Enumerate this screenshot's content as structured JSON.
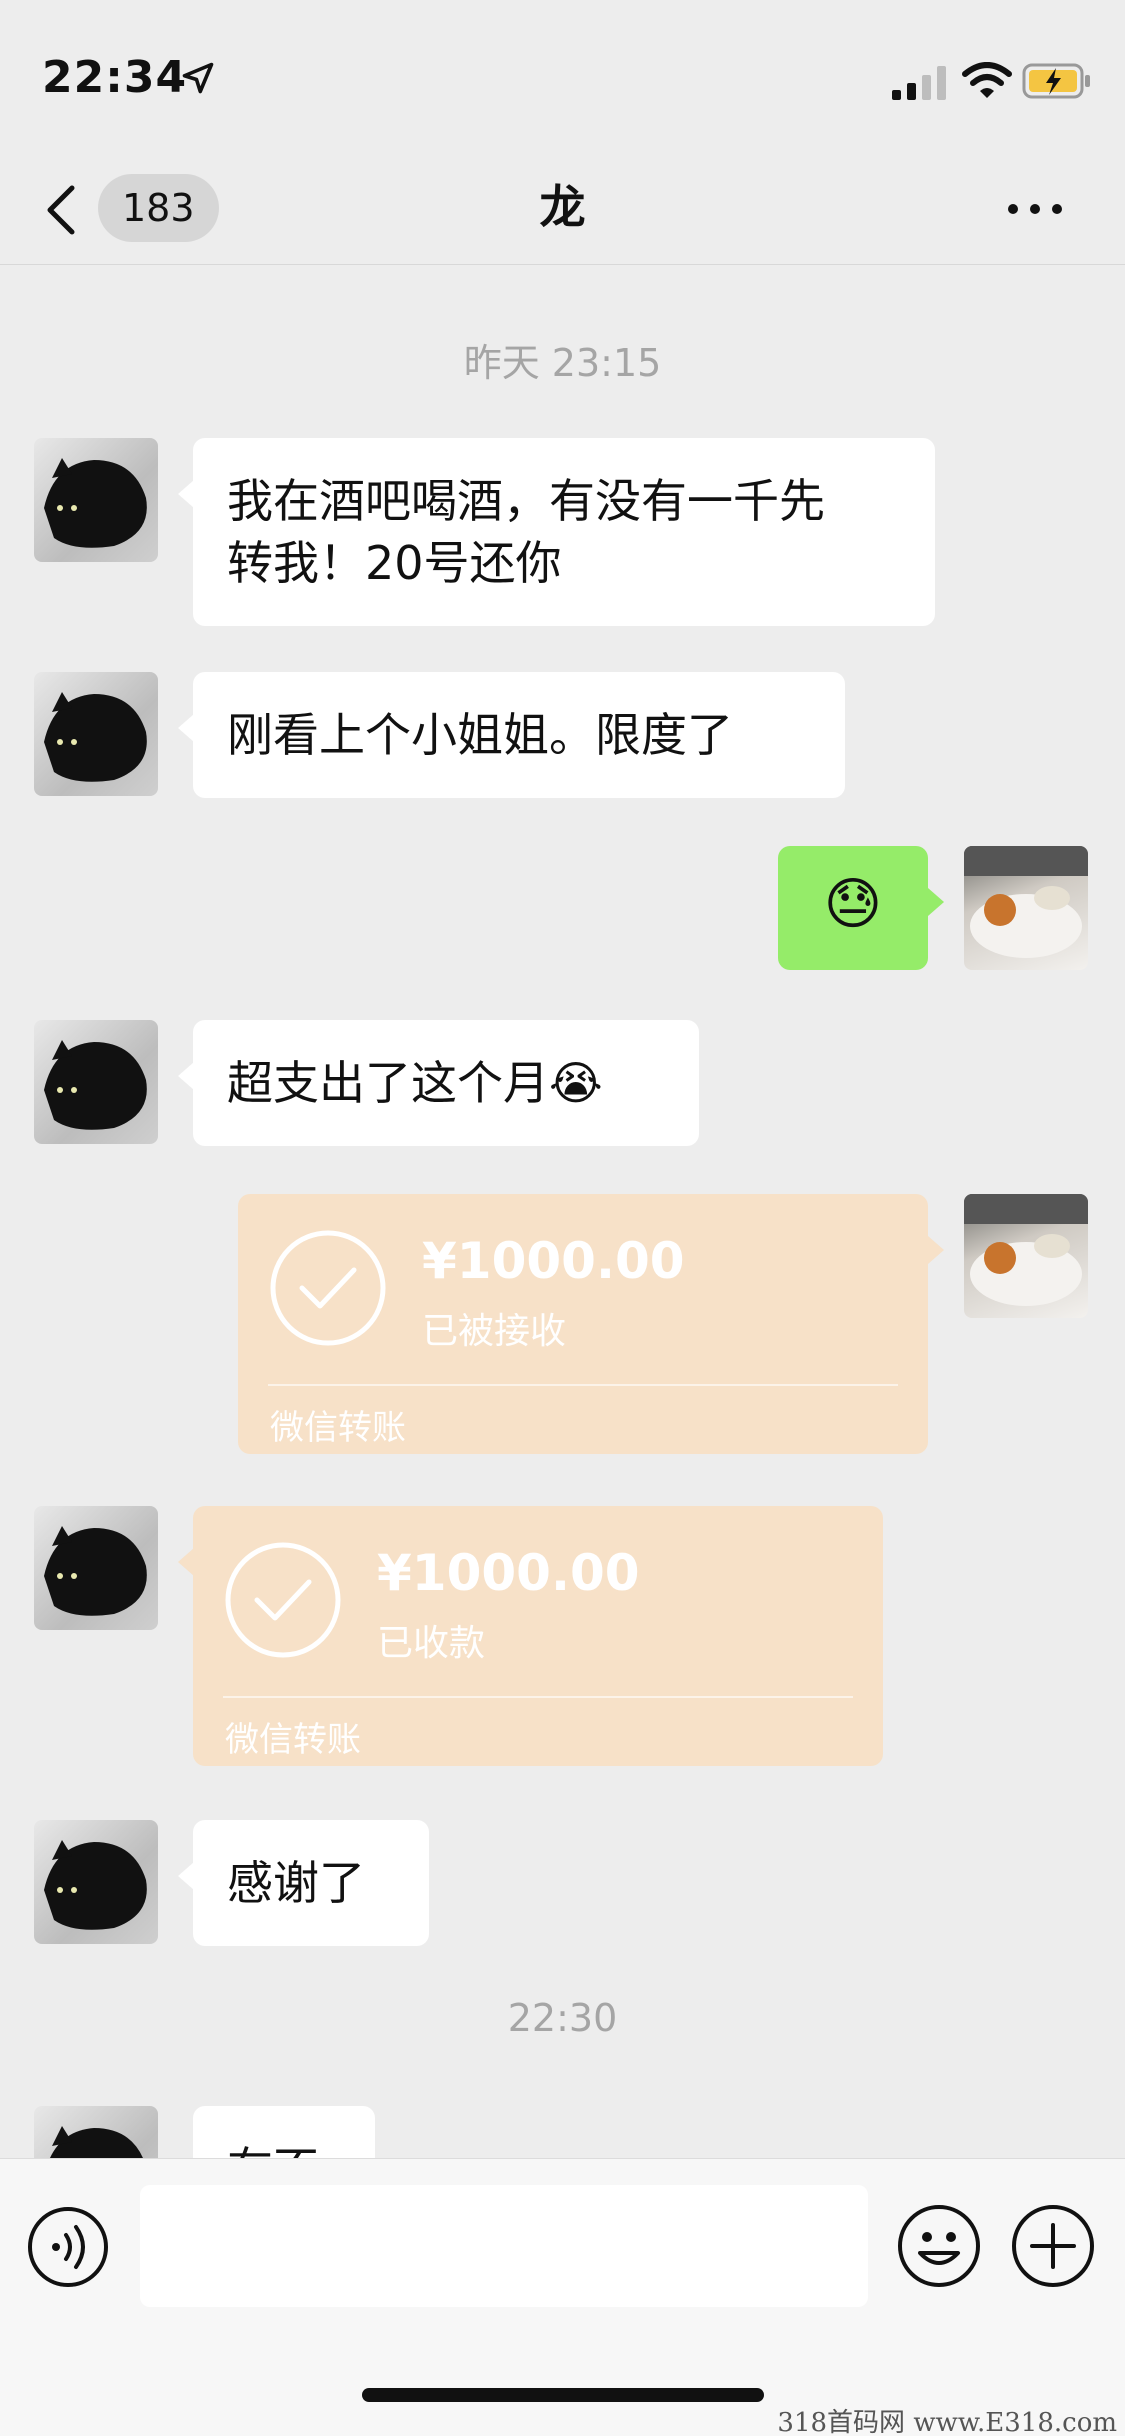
{
  "status_bar": {
    "time": "22:34",
    "location_icon": "location-arrow-icon",
    "signal_icon": "cellular-signal-icon",
    "wifi_icon": "wifi-icon",
    "battery_icon": "battery-charging-icon"
  },
  "nav": {
    "back_icon": "chevron-left-icon",
    "unread_count": "183",
    "title": "龙",
    "more_icon": "more-dots-icon"
  },
  "messages": [
    {
      "type": "timestamp",
      "text": "昨天 23:15"
    },
    {
      "type": "text",
      "side": "in",
      "text": "我在酒吧喝酒，有没有一千先\n转我！20号还你"
    },
    {
      "type": "text",
      "side": "in",
      "text": "刚看上个小姐姐。限度了"
    },
    {
      "type": "emoji",
      "side": "out",
      "text": "😓"
    },
    {
      "type": "text",
      "side": "in",
      "text": "超支出了这个月😭"
    },
    {
      "type": "transfer",
      "side": "out",
      "amount": "¥1000.00",
      "status": "已被接收",
      "footer": "微信转账"
    },
    {
      "type": "transfer",
      "side": "in",
      "amount": "¥1000.00",
      "status": "已收款",
      "footer": "微信转账"
    },
    {
      "type": "text",
      "side": "in",
      "text": "感谢了"
    },
    {
      "type": "timestamp",
      "text": "22:30"
    },
    {
      "type": "text",
      "side": "in",
      "text": "在不"
    }
  ],
  "input_bar": {
    "voice_icon": "voice-input-icon",
    "input_value": "",
    "emoji_icon": "emoji-smile-icon",
    "plus_icon": "plus-circle-icon"
  },
  "watermark": "318首码网  www.E318.com",
  "colors": {
    "background": "#ededed",
    "outgoing_bubble": "#95ec69",
    "incoming_bubble": "#ffffff",
    "transfer_card": "#f7e1c8",
    "timestamp_text": "#a5a5a5"
  }
}
